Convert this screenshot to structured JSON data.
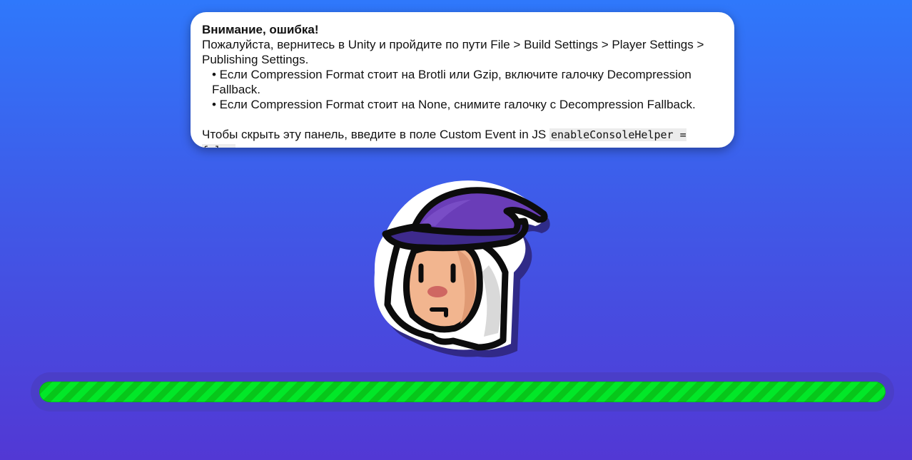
{
  "panel": {
    "title": "Внимание, ошибка!",
    "line1": "Пожалуйста, вернитесь в Unity и пройдите по пути File > Build Settings > Player Settings > Publishing Settings.",
    "bullet1": "• Если Compression Format стоит на Brotli или Gzip, включите галочку Decompression Fallback.",
    "bullet2": "• Если Compression Format стоит на None, снимите галочку с Decompression Fallback.",
    "hide_text": "Чтобы скрыть эту панель, введите в поле Custom Event in JS ",
    "hide_code": "enableConsoleHelper = false"
  },
  "mascot": {
    "icon": "wizard-mascot-icon"
  },
  "progress": {
    "value": 1.0
  },
  "colors": {
    "background_top": "#2f78fb",
    "background_bottom": "#5238d4",
    "progress_green": "#02e728",
    "progress_dark_green": "#07c61a",
    "hat_purple": "#5b32a8"
  }
}
